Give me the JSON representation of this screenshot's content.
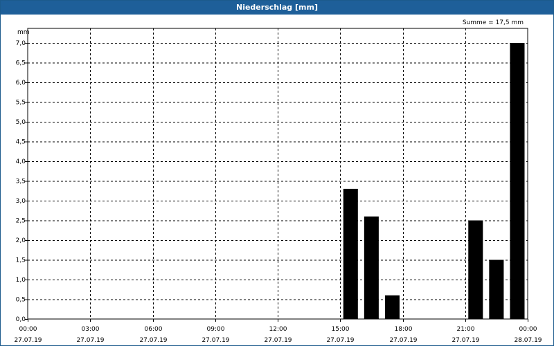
{
  "title": "Niederschlag [mm]",
  "unit_label": "mm",
  "summary": "Summe = 17,5 mm",
  "chart_data": {
    "type": "bar",
    "title": "Niederschlag [mm]",
    "ylabel": "mm",
    "ylim": [
      0,
      7.0
    ],
    "ytick_step": 0.5,
    "y_ticks": [
      "0,0",
      "0,5",
      "1,0",
      "1,5",
      "2,0",
      "2,5",
      "3,0",
      "3,5",
      "4,0",
      "4,5",
      "5,0",
      "5,5",
      "6,0",
      "6,5",
      "7,0"
    ],
    "x_range_hours": [
      0,
      24
    ],
    "x_ticks": [
      {
        "hour": 0,
        "time": "00:00",
        "date": "27.07.19"
      },
      {
        "hour": 3,
        "time": "03:00",
        "date": "27.07.19"
      },
      {
        "hour": 6,
        "time": "06:00",
        "date": "27.07.19"
      },
      {
        "hour": 9,
        "time": "09:00",
        "date": "27.07.19"
      },
      {
        "hour": 12,
        "time": "12:00",
        "date": "27.07.19"
      },
      {
        "hour": 15,
        "time": "15:00",
        "date": "27.07.19"
      },
      {
        "hour": 18,
        "time": "18:00",
        "date": "27.07.19"
      },
      {
        "hour": 21,
        "time": "21:00",
        "date": "27.07.19"
      },
      {
        "hour": 24,
        "time": "00:00",
        "date": "28.07.19"
      }
    ],
    "bars": [
      {
        "hour": 15.5,
        "value": 3.3
      },
      {
        "hour": 16.5,
        "value": 2.6
      },
      {
        "hour": 17.5,
        "value": 0.6
      },
      {
        "hour": 21.5,
        "value": 2.5
      },
      {
        "hour": 22.5,
        "value": 1.5
      },
      {
        "hour": 23.5,
        "value": 7.0
      }
    ],
    "grid": true,
    "colors": {
      "bar": "#000000",
      "grid": "#000000",
      "titlebar": "#1e5f99"
    }
  }
}
